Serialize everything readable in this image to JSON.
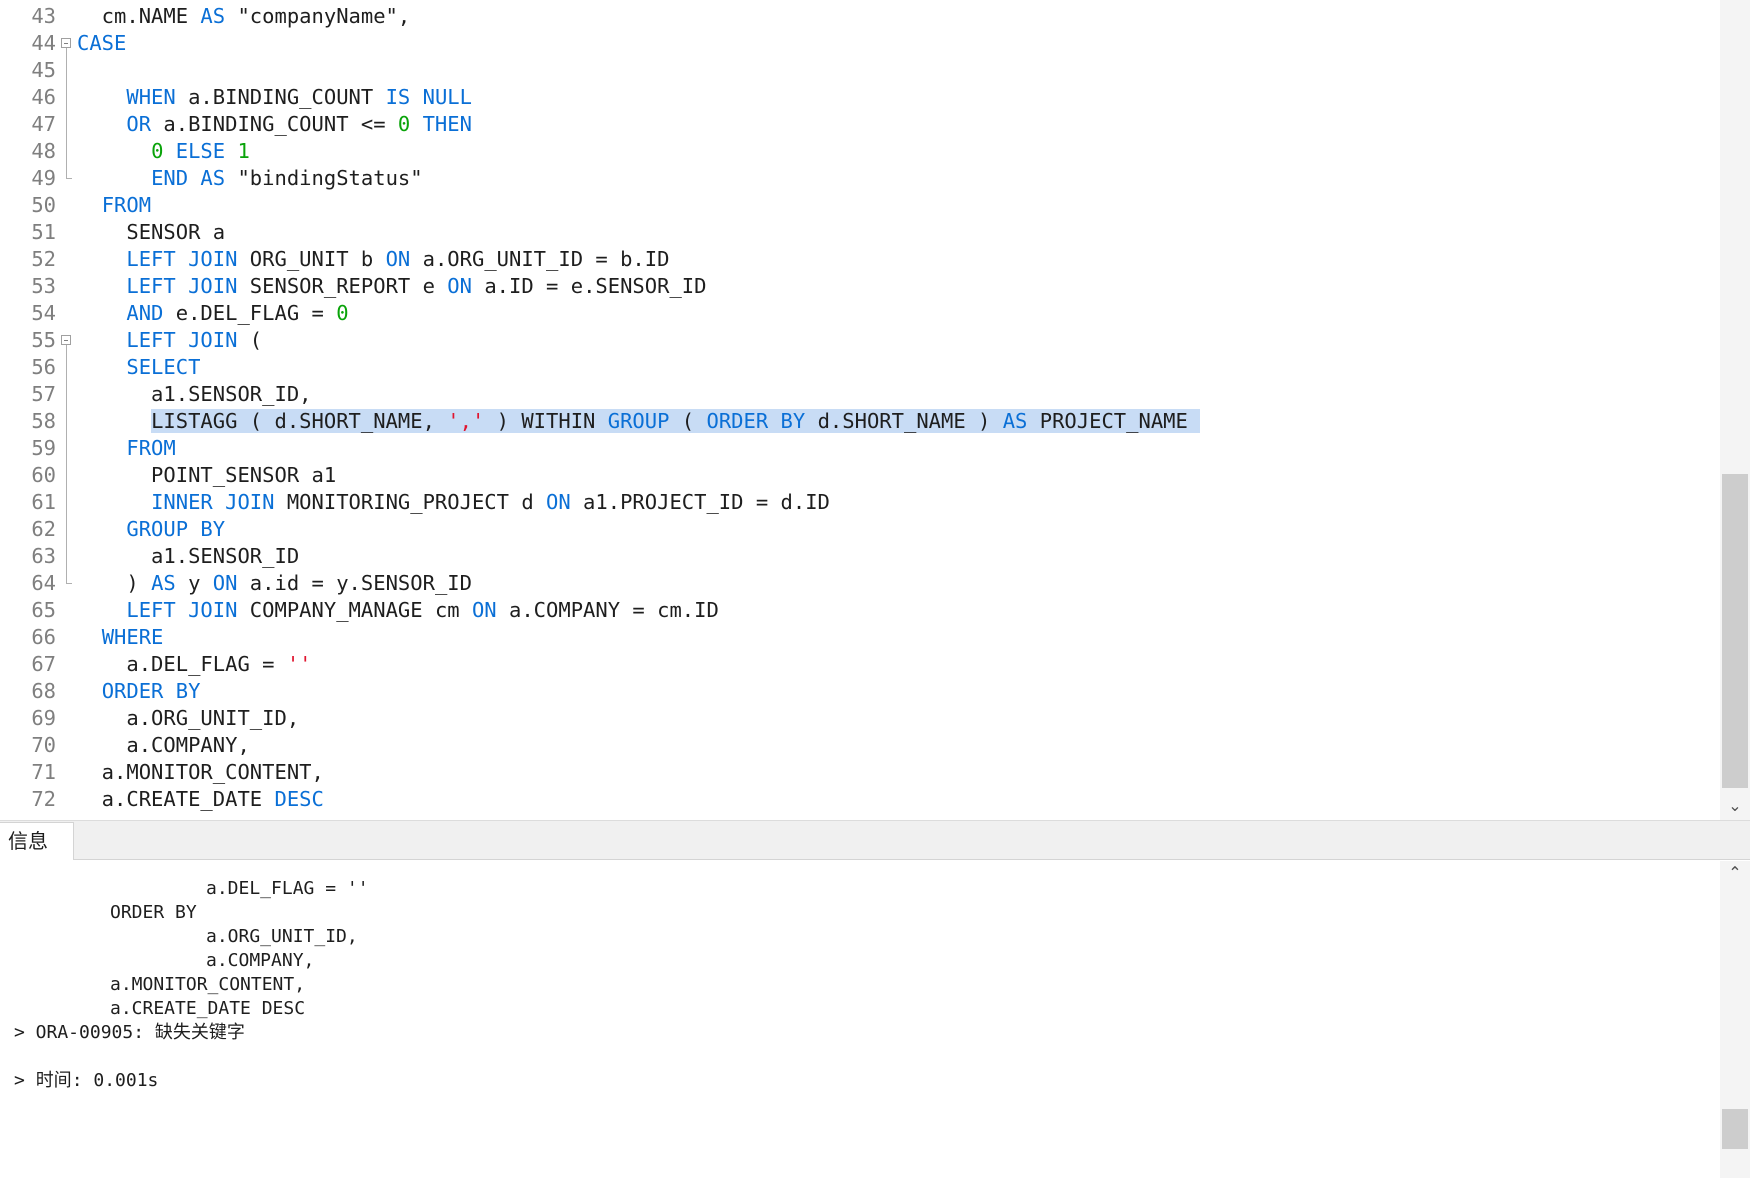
{
  "editor": {
    "lines": [
      {
        "num": "43",
        "fold": "",
        "tokens": [
          [
            "id",
            "  cm.NAME "
          ],
          [
            "kw",
            "AS"
          ],
          [
            "id",
            " \"companyName\","
          ]
        ]
      },
      {
        "num": "44",
        "fold": "open",
        "tokens": [
          [
            "kw",
            "CASE"
          ]
        ]
      },
      {
        "num": "45",
        "fold": "line",
        "tokens": []
      },
      {
        "num": "46",
        "fold": "line",
        "tokens": [
          [
            "id",
            "    "
          ],
          [
            "kw",
            "WHEN"
          ],
          [
            "id",
            " a.BINDING_COUNT "
          ],
          [
            "kw",
            "IS NULL"
          ]
        ]
      },
      {
        "num": "47",
        "fold": "line",
        "tokens": [
          [
            "id",
            "    "
          ],
          [
            "kw",
            "OR"
          ],
          [
            "id",
            " a.BINDING_COUNT <= "
          ],
          [
            "num",
            "0"
          ],
          [
            "id",
            " "
          ],
          [
            "kw",
            "THEN"
          ]
        ]
      },
      {
        "num": "48",
        "fold": "line",
        "tokens": [
          [
            "id",
            "      "
          ],
          [
            "num",
            "0"
          ],
          [
            "id",
            " "
          ],
          [
            "kw",
            "ELSE"
          ],
          [
            "id",
            " "
          ],
          [
            "num",
            "1"
          ]
        ]
      },
      {
        "num": "49",
        "fold": "end",
        "tokens": [
          [
            "id",
            "      "
          ],
          [
            "kw",
            "END AS"
          ],
          [
            "id",
            " \"bindingStatus\""
          ]
        ]
      },
      {
        "num": "50",
        "fold": "",
        "tokens": [
          [
            "id",
            "  "
          ],
          [
            "kw",
            "FROM"
          ]
        ]
      },
      {
        "num": "51",
        "fold": "",
        "tokens": [
          [
            "id",
            "    SENSOR a"
          ]
        ]
      },
      {
        "num": "52",
        "fold": "",
        "tokens": [
          [
            "id",
            "    "
          ],
          [
            "kw",
            "LEFT JOIN"
          ],
          [
            "id",
            " ORG_UNIT b "
          ],
          [
            "kw",
            "ON"
          ],
          [
            "id",
            " a.ORG_UNIT_ID = b.ID"
          ]
        ]
      },
      {
        "num": "53",
        "fold": "",
        "tokens": [
          [
            "id",
            "    "
          ],
          [
            "kw",
            "LEFT JOIN"
          ],
          [
            "id",
            " SENSOR_REPORT e "
          ],
          [
            "kw",
            "ON"
          ],
          [
            "id",
            " a.ID = e.SENSOR_ID"
          ]
        ]
      },
      {
        "num": "54",
        "fold": "",
        "tokens": [
          [
            "id",
            "    "
          ],
          [
            "kw",
            "AND"
          ],
          [
            "id",
            " e.DEL_FLAG = "
          ],
          [
            "num",
            "0"
          ]
        ]
      },
      {
        "num": "55",
        "fold": "open",
        "tokens": [
          [
            "id",
            "    "
          ],
          [
            "kw",
            "LEFT JOIN"
          ],
          [
            "id",
            " ("
          ]
        ]
      },
      {
        "num": "56",
        "fold": "line",
        "tokens": [
          [
            "id",
            "    "
          ],
          [
            "kw",
            "SELECT"
          ]
        ]
      },
      {
        "num": "57",
        "fold": "line",
        "tokens": [
          [
            "id",
            "      a1.SENSOR_ID,"
          ]
        ]
      },
      {
        "num": "58",
        "fold": "line",
        "highlight": true,
        "tokens": [
          [
            "id",
            "      LISTAGG ( d.SHORT_NAME, "
          ],
          [
            "str",
            "','"
          ],
          [
            "id",
            " ) WITHIN "
          ],
          [
            "kw",
            "GROUP"
          ],
          [
            "id",
            " ( "
          ],
          [
            "kw",
            "ORDER BY"
          ],
          [
            "id",
            " d.SHORT_NAME ) "
          ],
          [
            "kw",
            "AS"
          ],
          [
            "id",
            " PROJECT_NAME "
          ]
        ]
      },
      {
        "num": "59",
        "fold": "line",
        "tokens": [
          [
            "id",
            "    "
          ],
          [
            "kw",
            "FROM"
          ]
        ]
      },
      {
        "num": "60",
        "fold": "line",
        "tokens": [
          [
            "id",
            "      POINT_SENSOR a1"
          ]
        ]
      },
      {
        "num": "61",
        "fold": "line",
        "tokens": [
          [
            "id",
            "      "
          ],
          [
            "kw",
            "INNER JOIN"
          ],
          [
            "id",
            " MONITORING_PROJECT d "
          ],
          [
            "kw",
            "ON"
          ],
          [
            "id",
            " a1.PROJECT_ID = d.ID"
          ]
        ]
      },
      {
        "num": "62",
        "fold": "line",
        "tokens": [
          [
            "id",
            "    "
          ],
          [
            "kw",
            "GROUP BY"
          ]
        ]
      },
      {
        "num": "63",
        "fold": "line",
        "tokens": [
          [
            "id",
            "      a1.SENSOR_ID"
          ]
        ]
      },
      {
        "num": "64",
        "fold": "end",
        "tokens": [
          [
            "id",
            "    ) "
          ],
          [
            "kw",
            "AS"
          ],
          [
            "id",
            " y "
          ],
          [
            "kw",
            "ON"
          ],
          [
            "id",
            " a.id = y.SENSOR_ID"
          ]
        ]
      },
      {
        "num": "65",
        "fold": "",
        "tokens": [
          [
            "id",
            "    "
          ],
          [
            "kw",
            "LEFT JOIN"
          ],
          [
            "id",
            " COMPANY_MANAGE cm "
          ],
          [
            "kw",
            "ON"
          ],
          [
            "id",
            " a.COMPANY = cm.ID"
          ]
        ]
      },
      {
        "num": "66",
        "fold": "",
        "tokens": [
          [
            "id",
            "  "
          ],
          [
            "kw",
            "WHERE"
          ]
        ]
      },
      {
        "num": "67",
        "fold": "",
        "tokens": [
          [
            "id",
            "    a.DEL_FLAG = "
          ],
          [
            "str",
            "''"
          ]
        ]
      },
      {
        "num": "68",
        "fold": "",
        "tokens": [
          [
            "id",
            "  "
          ],
          [
            "kw",
            "ORDER BY"
          ]
        ]
      },
      {
        "num": "69",
        "fold": "",
        "tokens": [
          [
            "id",
            "    a.ORG_UNIT_ID,"
          ]
        ]
      },
      {
        "num": "70",
        "fold": "",
        "tokens": [
          [
            "id",
            "    a.COMPANY,"
          ]
        ]
      },
      {
        "num": "71",
        "fold": "",
        "tokens": [
          [
            "id",
            "  a.MONITOR_CONTENT,"
          ]
        ]
      },
      {
        "num": "72",
        "fold": "",
        "tokens": [
          [
            "id",
            "  a.CREATE_DATE "
          ],
          [
            "kw",
            "DESC"
          ]
        ]
      }
    ]
  },
  "tabs": {
    "info_label": "信息"
  },
  "output": {
    "lines": [
      "\t\ta.DEL_FLAG = ''",
      "\tORDER BY",
      "\t\ta.ORG_UNIT_ID,",
      "\t\ta.COMPANY,",
      "\ta.MONITOR_CONTENT,",
      "\ta.CREATE_DATE DESC",
      "> ORA-00905: 缺失关键字",
      "",
      "> 时间: 0.001s"
    ]
  },
  "colors": {
    "keyword": "#0a6fd6",
    "number": "#09a309",
    "string": "#e0152f",
    "text": "#1e1e1e",
    "line_number": "#7f7f7f",
    "selection": "#c8dcf5"
  },
  "icons": {
    "scroll_up": "chevron-up-icon",
    "scroll_down": "chevron-down-icon",
    "fold": "fold-minus-icon"
  }
}
